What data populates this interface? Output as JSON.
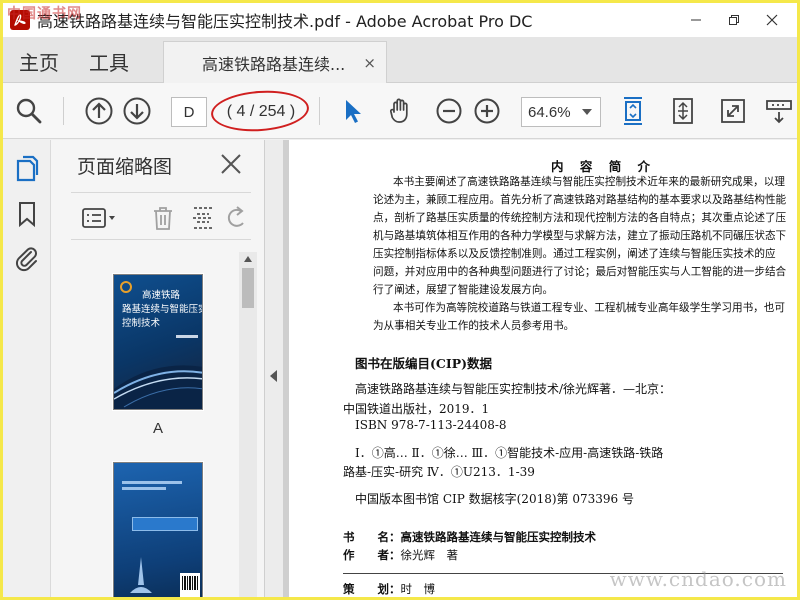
{
  "window": {
    "title": "高速铁路路基连续与智能压实控制技术.pdf - Adobe Acrobat Pro DC",
    "controls": [
      "minimize",
      "maximize",
      "close"
    ]
  },
  "watermark": {
    "logo": "中国通书网",
    "url": "www.cndao.com"
  },
  "nav_tabs": {
    "home": "主页",
    "tools": "工具",
    "document": "高速铁路路基连续...",
    "document_close": "×"
  },
  "toolbar": {
    "page_input": "D",
    "page_count": "( 4 / 254 )",
    "zoom": "64.6%",
    "icons": [
      "search-icon",
      "page-up-icon",
      "page-down-icon",
      "select-arrow-icon",
      "hand-icon",
      "zoom-out-icon",
      "zoom-in-icon",
      "fit-page-icon",
      "scroll-mode-icon",
      "fullscreen-icon",
      "read-mode-icon"
    ]
  },
  "colors": {
    "accent": "#1a6fc4",
    "highlight_ring": "#d01f1f",
    "watermark_border": "#f5e84a"
  },
  "thumbnail_panel": {
    "title": "页面缩略图",
    "thumbs": [
      {
        "title_lines": [
          "高速铁路",
          "路基连续与智能压实",
          "控制技术"
        ],
        "label": "A"
      },
      {
        "title_lines": [],
        "label": ""
      }
    ]
  },
  "document": {
    "intro_heading": "内 容 简 介",
    "intro_lines": [
      "本书主要阐述了高速铁路路基连续与智能压实控制技术近年来的最新研究成果，以理",
      "论述为主，兼顾工程应用。首先分析了高速铁路对路基结构的基本要求以及路基结构性能",
      "点，剖析了路基压实质量的传统控制方法和现代控制方法的各自特点；其次重点论述了压",
      "机与路基填筑体相互作用的各种力学模型与求解方法，建立了振动压路机不同碾压状态下",
      "压实控制指标体系以及反馈控制准则。通过工程实例，阐述了连续与智能压实技术的应",
      "问题，并对应用中的各种典型问题进行了讨论；最后对智能压实与人工智能的进一步结合",
      "行了阐述，展望了智能建设发展方向。",
      "本书可作为高等院校道路与铁道工程专业、工程机械专业高年级学生学习用书，也可",
      "为从事相关专业工作的技术人员参考用书。"
    ],
    "cip_heading": "图书在版编目(CIP)数据",
    "cip_lines": [
      "高速铁路路基连续与智能压实控制技术/徐光辉著．—北京：",
      "中国铁道出版社，2019．1",
      "ISBN 978-7-113-24408-8",
      "Ⅰ．①高… Ⅱ．①徐… Ⅲ．①智能技术-应用-高速铁路-铁路",
      "路基-压实-研究 Ⅳ．①U213．1-39",
      "中国版本图书馆 CIP 数据核字(2018)第 073396 号"
    ],
    "meta": [
      {
        "key": "书　　名：",
        "value": "高速铁路路基连续与智能压实控制技术"
      },
      {
        "key": "作　　者：",
        "value": "徐光辉　著"
      },
      {
        "key": "策　　划：",
        "value": "时　博"
      }
    ]
  }
}
